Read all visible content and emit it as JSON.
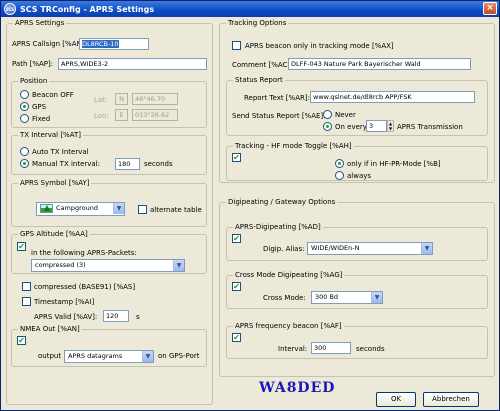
{
  "window": {
    "title": "SCS TRConfig - APRS Settings",
    "icon_text": "SCS"
  },
  "aprs_settings": {
    "title": "APRS Settings",
    "callsign_label": "APRS Callsign [%AM]:",
    "callsign_value": "DL8RCB-10",
    "path_label": "Path [%AP]:",
    "path_value": "APRS,WIDE3-2"
  },
  "position": {
    "title": "Position",
    "beacon_off": "Beacon OFF",
    "gps": "GPS",
    "fixed": "Fixed",
    "lat_label": "Lat:",
    "lat_dir": "N",
    "lat_value": "48°46.70",
    "lon_label": "Lon:",
    "lon_dir": "E",
    "lon_value": "013°26.62"
  },
  "tx_interval": {
    "title": "TX Interval [%AT]",
    "auto": "Auto TX Interval",
    "manual": "Manual TX interval:",
    "value": "180",
    "unit": "seconds"
  },
  "aprs_symbol": {
    "title": "APRS Symbol [%AY]",
    "value": "Campground",
    "alternate": "alternate table"
  },
  "gps_altitude": {
    "title": "GPS Altitude [%AA]",
    "check": "✔",
    "in_packets": "in the following APRS-Packets:",
    "packets_value": "compressed (3)"
  },
  "misc": {
    "compressed": "compressed (BASE91) [%AS]",
    "timestamp": "Timestamp [%AI]",
    "valid_label": "APRS Valid [%AV]:",
    "valid_value": "120",
    "valid_unit": "s"
  },
  "nmea_out": {
    "title": "NMEA Out [%AN]",
    "output_label": "output",
    "output_value": "APRS datagrams",
    "output_suffix": "on GPS-Port"
  },
  "tracking_options": {
    "title": "Tracking Options",
    "beacon_tracking": "APRS beacon only in tracking mode [%AX]",
    "comment_label": "Comment [%AC]:",
    "comment_value": "DLFF-043 Nature Park Bayerischer Wald"
  },
  "status_report": {
    "title": "Status Report",
    "report_label": "Report Text [%AR]:",
    "report_value": "www.qslnet.de/dl8rcb  APP/FSK",
    "send_label": "Send Status Report [%AE]:",
    "never": "Never",
    "on_every": "On every",
    "every_value": "3",
    "every_suffix": "APRS Transmission"
  },
  "hf_toggle": {
    "title": "Tracking - HF mode Toggle [%AH]",
    "only_pr": "only if in HF-PR-Mode [%B]",
    "always": "always"
  },
  "digipeating": {
    "title": "Digipeating / Gateway Options",
    "aprs_digi_title": "APRS-Digipeating [%AD]",
    "alias_label": "Digip. Alias:",
    "alias_value": "WIDE/WIDEn-N",
    "cross_title": "Cross Mode Digipeating [%AG]",
    "cross_label": "Cross Mode:",
    "cross_value": "300 Bd",
    "freq_title": "APRS frequency beacon [%AF]",
    "interval_label": "Interval:",
    "interval_value": "300",
    "interval_unit": "seconds"
  },
  "footer": {
    "callsign": "WA8DED",
    "ok": "OK",
    "cancel": "Abbrechen"
  }
}
